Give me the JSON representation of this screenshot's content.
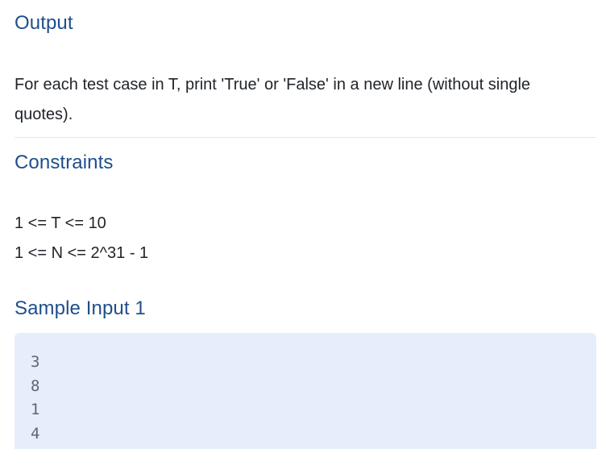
{
  "output": {
    "heading": "Output",
    "text": "For each test case in T, print 'True' or 'False' in a new line (without single quotes)."
  },
  "constraints": {
    "heading": "Constraints",
    "lines": [
      "1 <= T <= 10",
      "1 <= N <= 2^31 - 1"
    ]
  },
  "sample_input": {
    "heading": "Sample Input 1",
    "lines": [
      "3",
      "8",
      "1",
      "4"
    ]
  }
}
